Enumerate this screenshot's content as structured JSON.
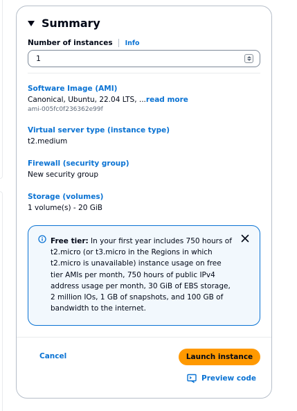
{
  "summary": {
    "title": "Summary",
    "instances": {
      "label": "Number of instances",
      "info_label": "Info",
      "value": "1"
    },
    "sections": [
      {
        "label": "Software Image (AMI)",
        "value": "Canonical, Ubuntu, 22.04 LTS, ...",
        "read_more": "read more",
        "sub": "ami-005fc0f236362e99f"
      },
      {
        "label": "Virtual server type (instance type)",
        "value": "t2.medium"
      },
      {
        "label": "Firewall (security group)",
        "value": "New security group"
      },
      {
        "label": "Storage (volumes)",
        "value": "1 volume(s) - 20 GiB"
      }
    ],
    "free_tier": {
      "heading": "Free tier:",
      "text": " In your first year includes 750 hours of t2.micro (or t3.micro in the Regions in which t2.micro is unavailable) instance usage on free tier AMIs per month, 750 hours of public IPv4 address usage per month, 30 GiB of EBS storage, 2 million IOs, 1 GB of snapshots, and 100 GB of bandwidth to the internet."
    },
    "actions": {
      "cancel": "Cancel",
      "launch": "Launch instance",
      "preview": "Preview code"
    }
  },
  "colors": {
    "accent_link": "#0972d3",
    "primary_button": "#ff9900",
    "info_bg": "#f2f8fd",
    "text": "#000716"
  },
  "icons": [
    "caret-down-icon",
    "stepper-icon",
    "info-circle-icon",
    "close-icon",
    "code-preview-icon"
  ]
}
